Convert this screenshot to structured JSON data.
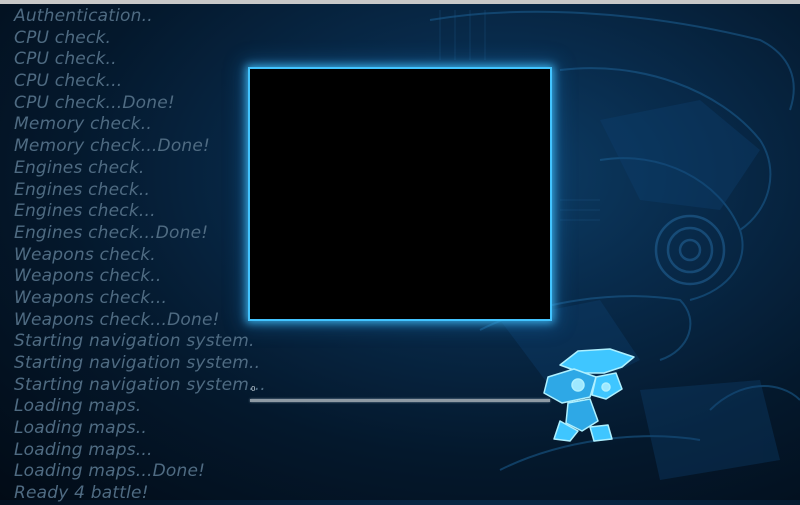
{
  "log_lines": [
    "Authentication..",
    "CPU check.",
    "CPU check..",
    "CPU check...",
    "CPU check...Done!",
    "Memory check..",
    "Memory check...Done!",
    "Engines check.",
    "Engines check..",
    "Engines check...",
    "Engines check...Done!",
    "Weapons check.",
    "Weapons check..",
    "Weapons check...",
    "Weapons check...Done!",
    "Starting navigation system.",
    "Starting navigation system..",
    "Starting navigation system...",
    "Loading maps.",
    "Loading maps..",
    "Loading maps...",
    "Loading maps...Done!",
    "Ready 4 battle!"
  ],
  "progress": {
    "label": "0",
    "value_percent": 0
  },
  "colors": {
    "frame_border": "#42c4ff",
    "log_text": "#4f6b82",
    "mascot_primary": "#3fc6ff"
  },
  "icons": {
    "mascot": "robot-mech-mascot"
  }
}
